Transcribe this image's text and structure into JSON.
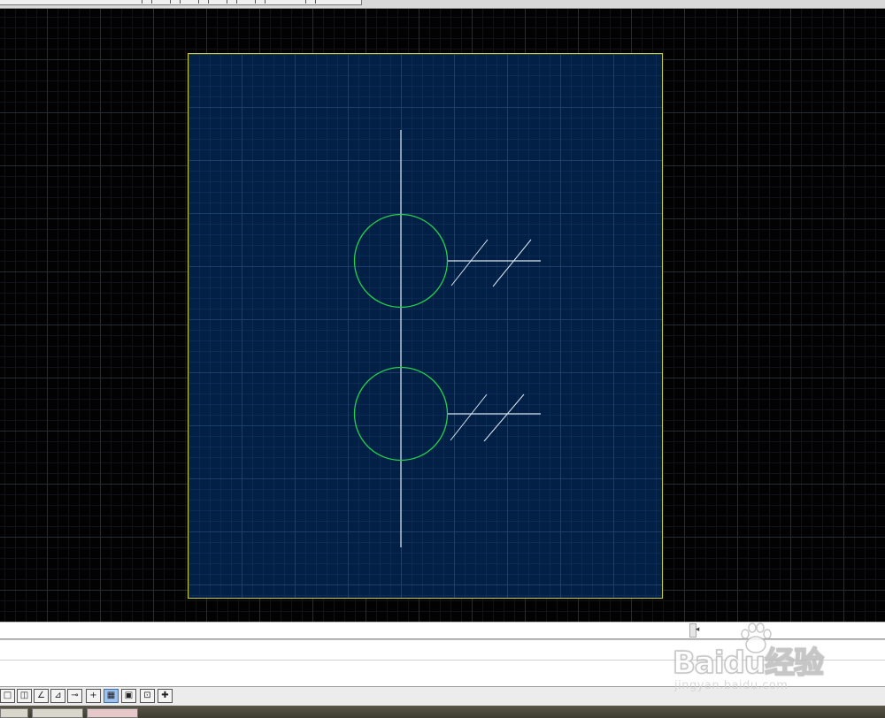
{
  "colors": {
    "sheet_fill": "#022046",
    "sheet_border": "#c9c93a",
    "circle_stroke": "#22d24a",
    "line_stroke": "#dce6f0",
    "model_space": "#020202"
  },
  "status_bar": {
    "icons": [
      "snap-icon",
      "grid-icon",
      "ortho-icon",
      "polar-icon",
      "osnap-icon",
      "otrack-icon",
      "ducs-icon",
      "dyn-icon",
      "lineweight-icon",
      "model-icon"
    ]
  },
  "watermark": {
    "brand": "Baidu",
    "suffix": "经验",
    "url": "jingyan.baidu.com"
  }
}
